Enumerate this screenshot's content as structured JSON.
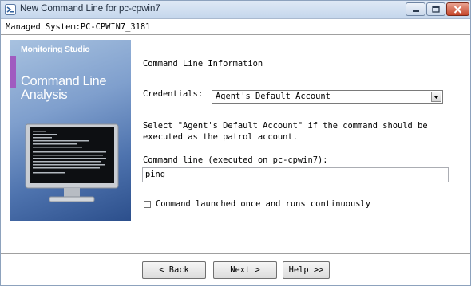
{
  "window": {
    "title": "New Command Line for pc-cpwin7",
    "icon": "app-icon",
    "controls": [
      "minimize-icon",
      "maximize-icon",
      "close-icon"
    ]
  },
  "header": {
    "managed_system": "Managed System:PC-CPWIN7_3181"
  },
  "banner": {
    "brand": "Monitoring Studio",
    "title_line1": "Command Line",
    "title_line2": "Analysis",
    "accent_color": "#a05bc0"
  },
  "form": {
    "section_title": "Command Line Information",
    "credentials_label": "Credentials:",
    "credentials_value": "Agent's Default Account",
    "help_text": "Select \"Agent's Default Account\" if the command should be executed as the patrol account.",
    "command_label": "Command line (executed on pc-cpwin7):",
    "command_value": "ping",
    "checkbox_label": "Command launched once and runs continuously",
    "checkbox_checked": false
  },
  "footer": {
    "back_label": "< Back",
    "next_label": "Next >",
    "help_label": "Help >>"
  }
}
